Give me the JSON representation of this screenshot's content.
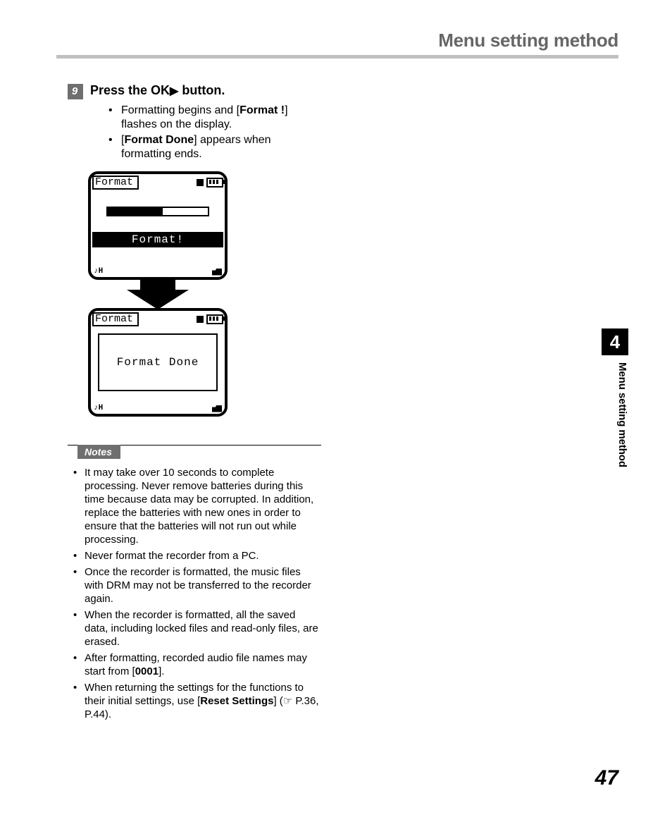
{
  "header": {
    "title": "Menu setting method"
  },
  "side_tab": {
    "chapter_num": "4",
    "chapter_text": "Menu setting method"
  },
  "page_number": "47",
  "step": {
    "number": "9",
    "prefix": "Press the ",
    "button_label": "OK",
    "play_glyph": "▶",
    "suffix": " button."
  },
  "bullets": {
    "b1_pre": "Formatting begins and [",
    "b1_bold": "Format !",
    "b1_post": "] flashes on the display.",
    "b2_pre": "[",
    "b2_bold": "Format Done",
    "b2_post": "] appears when formatting ends."
  },
  "lcd": {
    "title": "Format",
    "banner": "Format!",
    "done_msg": "Format Done",
    "mic_label": "♪H"
  },
  "notes": {
    "label": "Notes",
    "n1": "It may take over 10 seconds to complete processing. Never remove batteries during this time because data may be corrupted. In addition, replace the batteries with new ones in order to ensure that the batteries will not run out while processing.",
    "n2": "Never format the recorder from a PC.",
    "n3": "Once the recorder is formatted, the music files with DRM may not be transferred to the recorder again.",
    "n4": "When the recorder is formatted, all the saved data, including locked files and read-only files, are erased.",
    "n5_pre": "After formatting, recorded audio file names may start from [",
    "n5_bold": "0001",
    "n5_post": "].",
    "n6_pre": "When returning the settings for the functions to their initial settings, use [",
    "n6_bold": "Reset Settings",
    "n6_post": "] (☞ P.36, P.44)."
  }
}
